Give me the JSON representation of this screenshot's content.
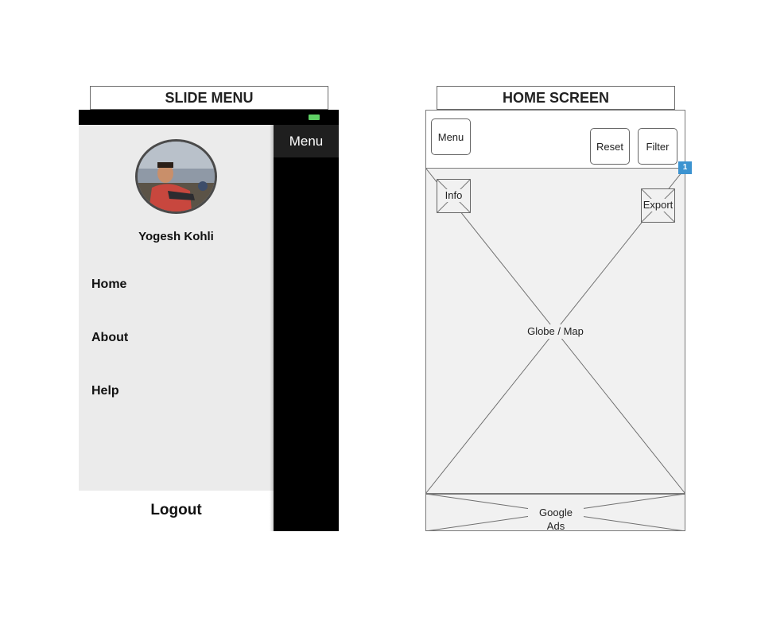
{
  "slide_menu": {
    "title": "SLIDE MENU",
    "menu_tab": "Menu",
    "user_name": "Yogesh Kohli",
    "nav_items": [
      "Home",
      "About",
      "Help"
    ],
    "logout": "Logout",
    "colors": {
      "drawer_bg": "#ebebeb",
      "dark_panel": "#000000",
      "battery": "#5fd065"
    }
  },
  "home_screen": {
    "title": "HOME SCREEN",
    "menu_button": "Menu",
    "reset_button": "Reset",
    "filter_button": "Filter",
    "info_button": "Info",
    "export_button": "Export",
    "map_label": "Globe / Map",
    "ads_label": "Google Ads",
    "badge": "1",
    "colors": {
      "placeholder_bg": "#f1f1f1",
      "badge": "#3c93d0"
    }
  }
}
